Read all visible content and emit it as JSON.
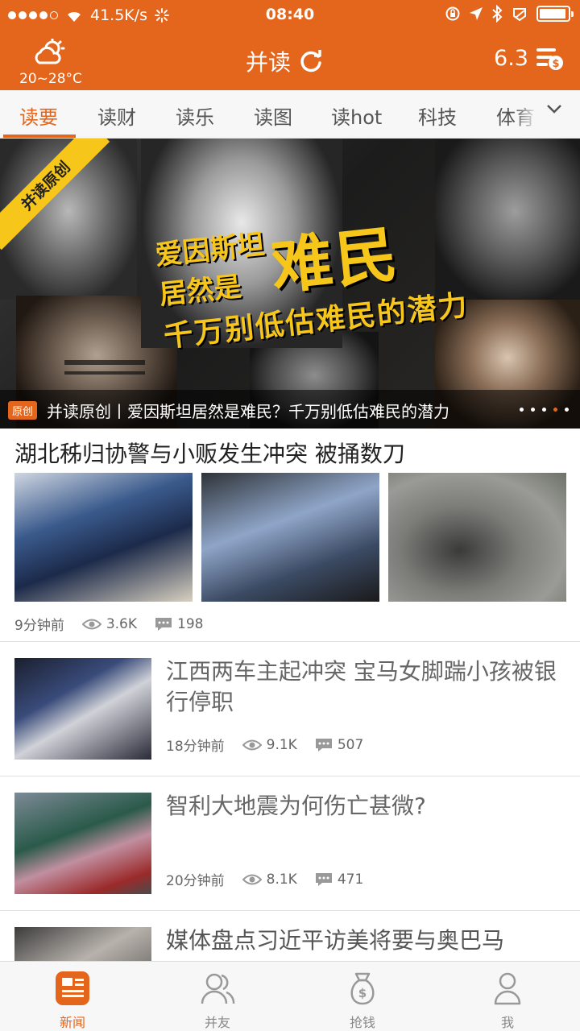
{
  "status": {
    "network_speed": "41.5K/s",
    "time": "08:40"
  },
  "header": {
    "weather_temp": "20~28°C",
    "title": "并读",
    "score": "6.3"
  },
  "tabs": [
    {
      "label": "读要"
    },
    {
      "label": "读财"
    },
    {
      "label": "读乐"
    },
    {
      "label": "读图"
    },
    {
      "label": "读hot"
    },
    {
      "label": "科技"
    },
    {
      "label": "体育"
    }
  ],
  "banner": {
    "ribbon": "并读原创",
    "headline_line1": "爱因斯坦",
    "headline_line2a": "居然是",
    "headline_big": "难民",
    "headline_line3": "千万别低估难民的潜力",
    "badge": "原创",
    "caption": "并读原创丨爱因斯坦居然是难民？千万别低估难民的潜力"
  },
  "news": [
    {
      "title": "湖北秭归协警与小贩发生冲突 被捅数刀",
      "time": "9分钟前",
      "views": "3.6K",
      "comments": "198"
    },
    {
      "title": "江西两车主起冲突 宝马女脚踹小孩被银行停职",
      "time": "18分钟前",
      "views": "9.1K",
      "comments": "507"
    },
    {
      "title": "智利大地震为何伤亡甚微?",
      "time": "20分钟前",
      "views": "8.1K",
      "comments": "471"
    },
    {
      "title": "媒体盘点习近平访美将要与奥巴马"
    }
  ],
  "bottom_nav": [
    {
      "label": "新闻"
    },
    {
      "label": "并友"
    },
    {
      "label": "抢钱"
    },
    {
      "label": "我"
    }
  ],
  "colors": {
    "brand": "#e4661c",
    "banner_yellow": "#f6c61a"
  }
}
